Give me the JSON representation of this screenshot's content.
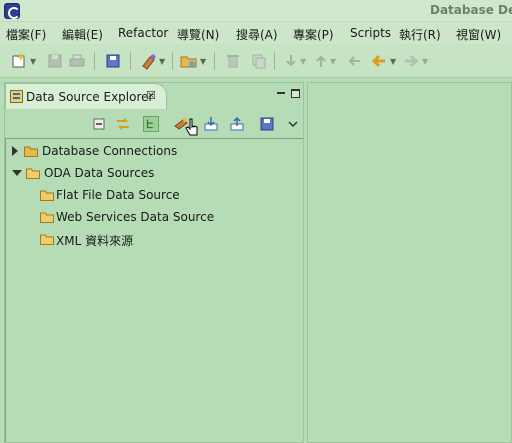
{
  "window": {
    "title": "Database Deve"
  },
  "menu": [
    {
      "label": "檔案(F)"
    },
    {
      "label": "編輯(E)"
    },
    {
      "label": "Refactor"
    },
    {
      "label": "導覽(N)"
    },
    {
      "label": "搜尋(A)"
    },
    {
      "label": "專案(P)"
    },
    {
      "label": "Scripts"
    },
    {
      "label": "執行(R)"
    },
    {
      "label": "視窗(W)"
    }
  ],
  "toolbar": {
    "icons": [
      "new-icon",
      "save-icon",
      "print-icon",
      "db-save-icon",
      "open-type-icon",
      "open-folder-icon",
      "delete-icon",
      "copy-icon",
      "next-annotation-icon",
      "prev-annotation-icon",
      "back-icon",
      "forward-icon"
    ]
  },
  "explorer": {
    "tab_label": "Data Source Explorer",
    "tab_close": "☒",
    "tree": [
      {
        "label": "Database Connections",
        "level": 0,
        "expanded": false
      },
      {
        "label": "ODA Data Sources",
        "level": 0,
        "expanded": true
      },
      {
        "label": "Flat File Data Source",
        "level": 1
      },
      {
        "label": "Web Services Data Source",
        "level": 1
      },
      {
        "label": "XML 資料來源",
        "level": 1
      }
    ]
  },
  "colors": {
    "background": "#b5dcb4",
    "folder": "#e8b84a",
    "accent": "#2b3f8f"
  }
}
